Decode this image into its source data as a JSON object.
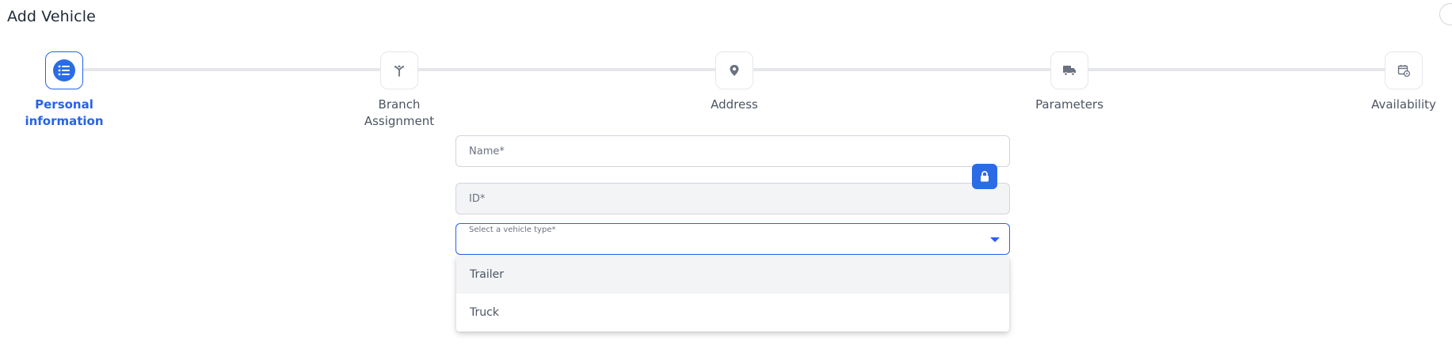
{
  "page": {
    "title": "Add Vehicle"
  },
  "stepper": {
    "steps": [
      {
        "label_line1": "Personal",
        "label_line2": "information",
        "icon": "list-icon",
        "active": true
      },
      {
        "label_line1": "Branch",
        "label_line2": "Assignment",
        "icon": "branch-icon",
        "active": false
      },
      {
        "label_line1": "Address",
        "label_line2": "",
        "icon": "location-pin-icon",
        "active": false
      },
      {
        "label_line1": "Parameters",
        "label_line2": "",
        "icon": "truck-icon",
        "active": false
      },
      {
        "label_line1": "Availability",
        "label_line2": "",
        "icon": "calendar-gear-icon",
        "active": false
      }
    ]
  },
  "form": {
    "name": {
      "placeholder": "Name*",
      "value": ""
    },
    "id": {
      "placeholder": "ID*",
      "value": ""
    },
    "lock_icon": "lock-icon",
    "vehicle_type": {
      "label": "Select a vehicle type*",
      "selected": "",
      "options": [
        "Trailer",
        "Truck"
      ]
    }
  },
  "colors": {
    "accent": "#2b6be6",
    "border": "#d1d5db",
    "disabled_bg": "#f3f4f6",
    "text": "#4b5563"
  }
}
